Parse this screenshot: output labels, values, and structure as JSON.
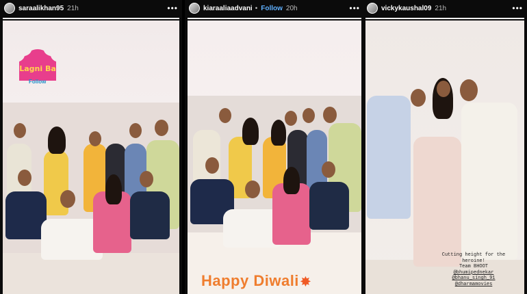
{
  "stories": [
    {
      "username": "saraalikhan95",
      "time": "21h",
      "follow": "",
      "progress": 1.0,
      "sticker_logo": "Lagni Ba",
      "sticker_sub": "Follow",
      "happy_text": "",
      "caption_lines": []
    },
    {
      "username": "kiaraaliaadvani",
      "time": "20h",
      "follow": "Follow",
      "progress": 1.0,
      "sticker_logo": "",
      "sticker_sub": "",
      "happy_text": "Happy Diwali",
      "caption_lines": []
    },
    {
      "username": "vickykaushal09",
      "time": "21h",
      "follow": "",
      "progress": 1.0,
      "caption_lines": [
        "Cutting height for the",
        "heroine!",
        "Team BHOOT",
        "@bhumipednekar",
        "@bhanu_singh_91",
        "@dharmamovies"
      ]
    }
  ],
  "separator": "•",
  "more_icon": "•••",
  "colors": {
    "follow": "#5fb0ff",
    "happy_text": "#ef7d2e",
    "logo_pink": "#e83e8c"
  }
}
